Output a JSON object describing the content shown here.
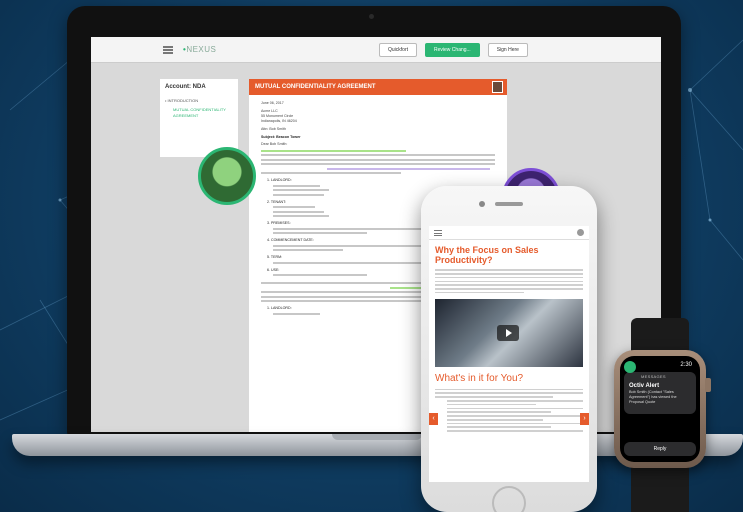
{
  "laptop": {
    "app": {
      "logo_prefix": "•",
      "logo": "NEXUS",
      "buttons": [
        "Quickfort",
        "Review Chang...",
        "Sign Here"
      ]
    },
    "sidebar": {
      "title": "Account: NDA",
      "section": "• INTRODUCTION",
      "link": "MUTUAL CONFIDENTIALITY AGREEMENT"
    },
    "document": {
      "title": "MUTUAL CONFIDENTIALITY AGREEMENT",
      "date": "June 06, 2017",
      "address": [
        "Acme LLC",
        "55 Monument Circle",
        "Indianapolis, IN 46204"
      ],
      "salutation": "Attn: Bob Smith",
      "subject": "Subject: Beacon Tower",
      "greeting": "Dear Bob Smith:",
      "items": [
        "1. LANDLORD:",
        "2. TENANT:",
        "3. PREMISES:",
        "4. COMMENCEMENT DATE:",
        "5. TERM:",
        "6. USE:"
      ],
      "item_last": "1. LANDLORD:"
    }
  },
  "phone": {
    "heading": "Why the Focus on Sales Productivity?",
    "subheading": "What's in it for You?",
    "prev_arrow": "‹",
    "next_arrow": "›"
  },
  "watch": {
    "time": "2:30",
    "app": "MESSAGES",
    "alert_title": "Octiv Alert",
    "alert_message": "Bob Smith (Contact \"Sales Agreement\") has viewed the Proposal Quote",
    "reply_label": "Reply"
  }
}
